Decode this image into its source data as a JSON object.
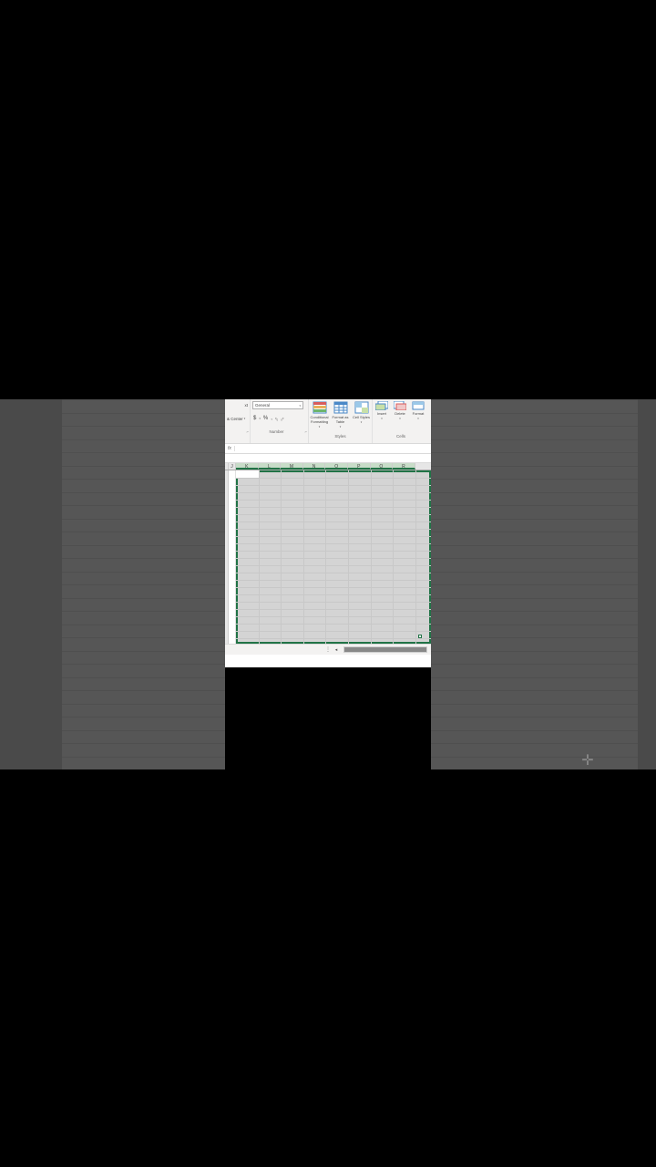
{
  "ribbon": {
    "alignment": {
      "wraptext_hint": "xt",
      "center_label": "& Center",
      "group_label": ""
    },
    "number": {
      "format_value": "General",
      "currency": "$",
      "percent": "%",
      "comma": ",",
      "dec_inc": ".0←",
      "dec_dec": ".00→",
      "group_label": "Number"
    },
    "styles": {
      "cond_fmt": "Conditional Formatting",
      "fmt_table": "Format as Table",
      "cell_styles": "Cell Styles",
      "group_label": "Styles"
    },
    "cells": {
      "insert": "Insert",
      "delete": "Delete",
      "format": "Format",
      "group_label": "Cells"
    }
  },
  "formula_bar": {
    "fx": "fx"
  },
  "columns": [
    "J",
    "K",
    "L",
    "M",
    "N",
    "O",
    "P",
    "Q",
    "R"
  ],
  "selection": {
    "active_col": "K",
    "start_col": "K",
    "end_col": "R"
  }
}
